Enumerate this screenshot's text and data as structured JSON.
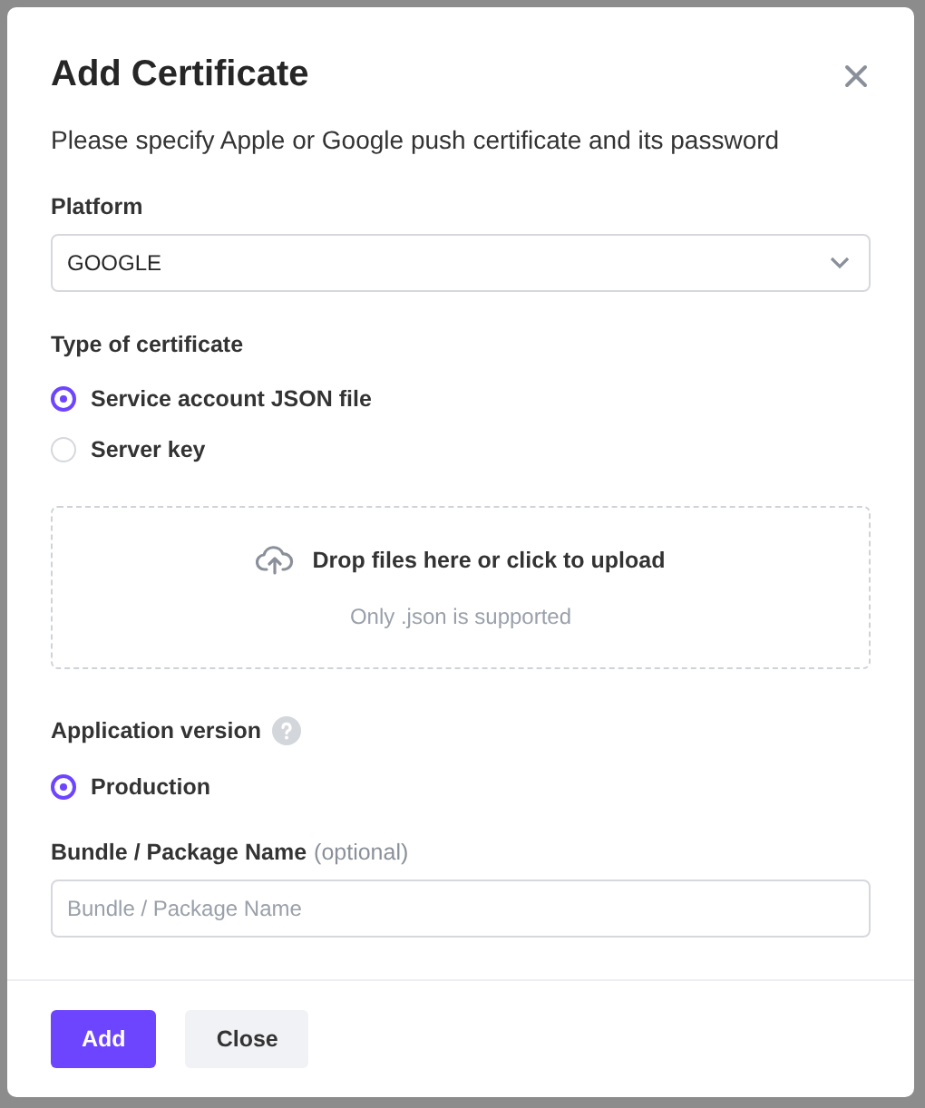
{
  "dialog": {
    "title": "Add Certificate",
    "subtitle": "Please specify Apple or Google push certificate and its password"
  },
  "platform": {
    "label": "Platform",
    "value": "GOOGLE"
  },
  "certificate_type": {
    "label": "Type of certificate",
    "options": [
      {
        "label": "Service account JSON file",
        "selected": true
      },
      {
        "label": "Server key",
        "selected": false
      }
    ]
  },
  "upload": {
    "text": "Drop files here or click to upload",
    "hint": "Only .json is supported"
  },
  "app_version": {
    "label": "Application version",
    "options": [
      {
        "label": "Production",
        "selected": true
      }
    ]
  },
  "bundle": {
    "label": "Bundle / Package Name",
    "note": "(optional)",
    "placeholder": "Bundle / Package Name"
  },
  "buttons": [
    {
      "label": "Add",
      "kind": "primary"
    },
    {
      "label": "Close",
      "kind": "secondary"
    }
  ]
}
